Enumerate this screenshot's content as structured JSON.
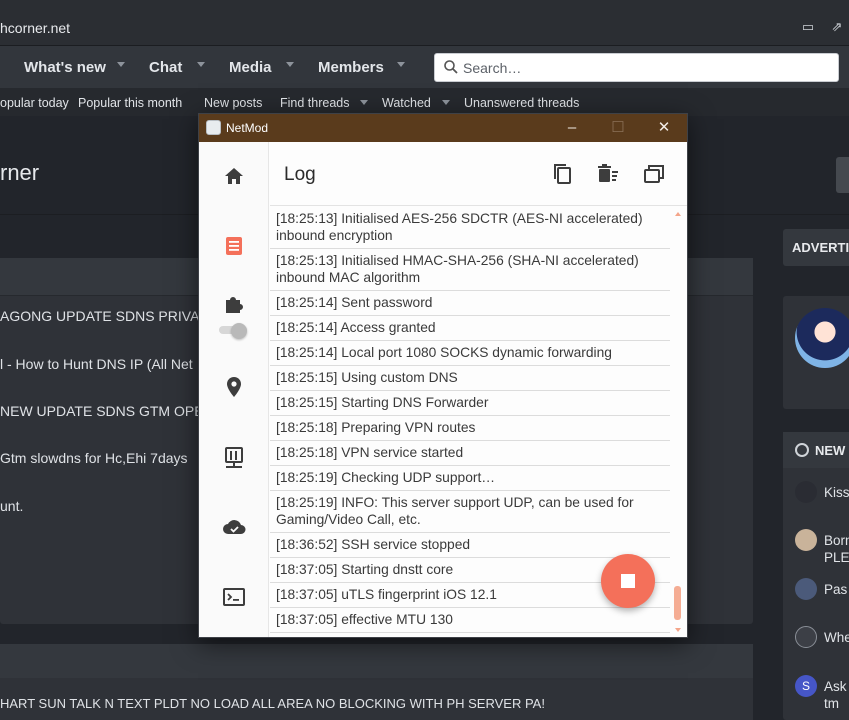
{
  "browser": {
    "url": "hcorner.net"
  },
  "forum": {
    "nav": [
      "What's new",
      "Chat",
      "Media",
      "Members"
    ],
    "search_placeholder": "Search…",
    "subnav": [
      "opular today",
      "Popular this month",
      "New posts",
      "Find threads",
      "Watched",
      "Unanswered threads"
    ],
    "page_title": "rner",
    "threads": [
      "AGONG UPDATE SDNS PRIVATE",
      "l - How to Hunt DNS IP (All Net",
      "NEW UPDATE SDNS GTM OPEN D",
      "Gtm slowdns for Hc,Ehi 7days",
      "unt."
    ],
    "lower_thread": "HART SUN TALK N TEXT PLDT NO LOAD ALL AREA NO BLOCKING WITH PH SERVER PA!",
    "sidebar": {
      "advertisement": "ADVERTI",
      "new_header": "NEW",
      "rows": [
        {
          "line1": "Kiss",
          "line2": ""
        },
        {
          "line1": "Born",
          "line2": "PLEA"
        },
        {
          "line1": "Pas",
          "line2": ""
        },
        {
          "line1": "Whe",
          "line2": ""
        },
        {
          "line1": "Ask",
          "line2": "tm"
        }
      ],
      "avatar_letter": "S"
    }
  },
  "netmod": {
    "title": "NetMod",
    "page": "Log",
    "rail_icons": [
      "home-icon",
      "log-icon",
      "plugin-icon",
      "location-icon",
      "server-icon",
      "cloud-icon",
      "terminal-icon"
    ],
    "toolbar_icons": [
      "copy-icon",
      "clear-log-icon",
      "window-icon"
    ],
    "log": [
      {
        "time": "[18:25:13]",
        "msg": "Initialised AES-256 SDCTR (AES-NI accelerated) inbound encryption"
      },
      {
        "time": "[18:25:13]",
        "msg": "Initialised HMAC-SHA-256 (SHA-NI accelerated) inbound MAC algorithm"
      },
      {
        "time": "[18:25:14]",
        "msg": "Sent password"
      },
      {
        "time": "[18:25:14]",
        "msg": "Access granted"
      },
      {
        "time": "[18:25:14]",
        "msg": "Local port 1080 SOCKS dynamic forwarding"
      },
      {
        "time": "[18:25:15]",
        "msg": "Using custom DNS"
      },
      {
        "time": "[18:25:15]",
        "msg": "Starting DNS Forwarder"
      },
      {
        "time": "[18:25:18]",
        "msg": "Preparing VPN routes"
      },
      {
        "time": "[18:25:18]",
        "msg": "VPN service started"
      },
      {
        "time": "[18:25:19]",
        "msg": "Checking UDP support…"
      },
      {
        "time": "[18:25:19]",
        "msg": "INFO: This server support UDP, can be used for Gaming/Video Call, etc."
      },
      {
        "time": "[18:36:52]",
        "msg": "SSH service stopped"
      },
      {
        "time": "[18:37:05]",
        "msg": "Starting dnstt core"
      },
      {
        "time": "[18:37:05]",
        "msg": "uTLS fingerprint iOS 12.1"
      },
      {
        "time": "[18:37:05]",
        "msg": "effective MTU 130"
      }
    ],
    "accent": "#f4705a",
    "titlebar_color": "#5a3b1c"
  }
}
